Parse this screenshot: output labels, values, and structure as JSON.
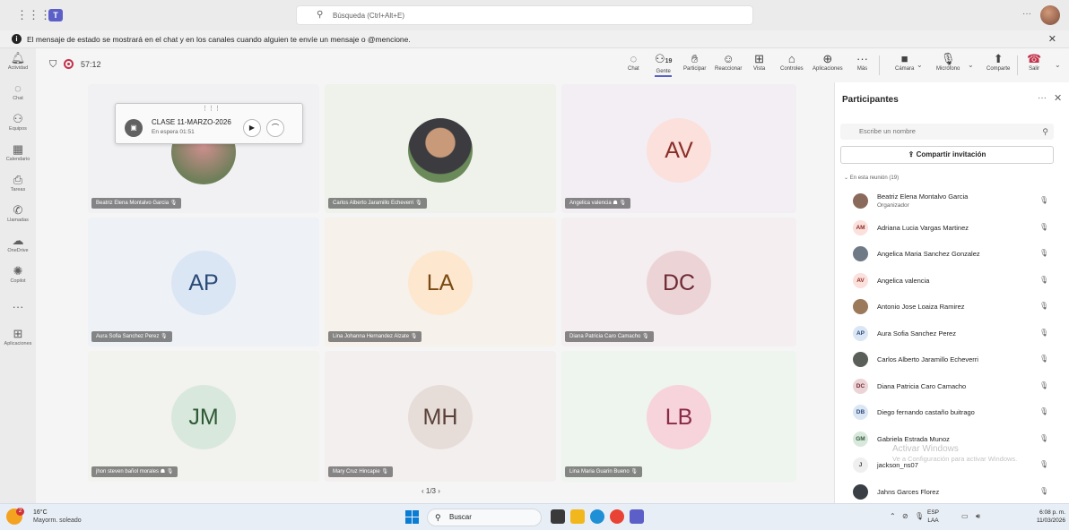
{
  "topbar": {
    "search_placeholder": "Búsqueda (Ctrl+Alt+E)",
    "more": "···"
  },
  "banner": {
    "text": "El mensaje de estado se mostrará en el chat y en los canales cuando alguien te envíe un mensaje o @mencione."
  },
  "rail": {
    "items": [
      {
        "label": "Actividad",
        "icon": "bell-icon"
      },
      {
        "label": "Chat",
        "icon": "chat-icon"
      },
      {
        "label": "Equipos",
        "icon": "teams-icon"
      },
      {
        "label": "Calendario",
        "icon": "calendar-icon"
      },
      {
        "label": "Tareas",
        "icon": "tasks-icon"
      },
      {
        "label": "Llamadas",
        "icon": "phone-icon"
      },
      {
        "label": "OneDrive",
        "icon": "cloud-icon"
      },
      {
        "label": "Copilot",
        "icon": "copilot-icon"
      },
      {
        "label": "",
        "icon": "more-icon"
      },
      {
        "label": "Aplicaciones",
        "icon": "apps-icon"
      }
    ]
  },
  "meeting": {
    "timer": "57:12",
    "controls": {
      "chat": "Chat",
      "people": "Gente",
      "people_count": "19",
      "raise": "Participar",
      "react": "Reaccionar",
      "view": "Vista",
      "controls": "Controles",
      "apps": "Aplicaciones",
      "more": "Más",
      "camera": "Cámara",
      "mic": "Micrófono",
      "share": "Comparte",
      "leave": "Salir"
    }
  },
  "popup": {
    "title": "CLASE 11-MARZO-2026",
    "status": "En espera   01:51"
  },
  "tiles": [
    {
      "name": "Beatriz Elena Montalvo Garcia",
      "initials": "",
      "bg": "#f1f1f4"
    },
    {
      "name": "Carlos Alberto Jaramillo Echeverri",
      "initials": "",
      "bg": "#eef2ea"
    },
    {
      "name": "Angelica valencia",
      "initials": "AV",
      "bg": "#f3eef4",
      "avatar_bg": "#fbe0dc",
      "avatar_fg": "#8b2e26"
    },
    {
      "name": "Aura Sofia Sanchez Perez",
      "initials": "AP",
      "bg": "#eef1f5",
      "avatar_bg": "#dbe6f4",
      "avatar_fg": "#2b4a78"
    },
    {
      "name": "Lina Johanna Hernandez Alzate",
      "initials": "LA",
      "bg": "#f6f1ea",
      "avatar_bg": "#fde7cf",
      "avatar_fg": "#7a4a10"
    },
    {
      "name": "Diana Patricia Caro Camacho",
      "initials": "DC",
      "bg": "#f4eef0",
      "avatar_bg": "#ecd3d6",
      "avatar_fg": "#6e2a34"
    },
    {
      "name": "jhon steven bañol morales",
      "initials": "JM",
      "bg": "#f2f2ee",
      "avatar_bg": "#d9e8dc",
      "avatar_fg": "#2e5a36"
    },
    {
      "name": "Mary Cruz Hincapie",
      "initials": "MH",
      "bg": "#f4efef",
      "avatar_bg": "#e6ddd9",
      "avatar_fg": "#5a4038"
    },
    {
      "name": "Lina Maria Guarin Bueno",
      "initials": "LB",
      "bg": "#eef4ee",
      "avatar_bg": "#f7d3dc",
      "avatar_fg": "#8a2a44"
    }
  ],
  "pager": "‹  1/3  ›",
  "panel": {
    "title": "Participantes",
    "search_placeholder": "Escribe un nombre",
    "invite": "Compartir invitación",
    "section": "En esta reunión (19)",
    "participants": [
      {
        "name": "Beatriz Elena Montalvo Garcia",
        "role": "Organizador",
        "initials": "",
        "av_bg": "#8a6a5a",
        "av_fg": "#fff"
      },
      {
        "name": "Adriana Lucia Vargas Martinez",
        "role": "",
        "initials": "AM",
        "av_bg": "#fbe0dc",
        "av_fg": "#8b2e26"
      },
      {
        "name": "Angelica Maria Sanchez Gonzalez",
        "role": "",
        "initials": "",
        "av_bg": "#6f7a86",
        "av_fg": "#fff"
      },
      {
        "name": "Angelica valencia",
        "role": "",
        "initials": "AV",
        "av_bg": "#fbe0dc",
        "av_fg": "#8b2e26"
      },
      {
        "name": "Antonio Jose Loaiza Ramirez",
        "role": "",
        "initials": "",
        "av_bg": "#9a7a5a",
        "av_fg": "#fff"
      },
      {
        "name": "Aura Sofia Sanchez Perez",
        "role": "",
        "initials": "AP",
        "av_bg": "#dbe6f4",
        "av_fg": "#2b4a78"
      },
      {
        "name": "Carlos Alberto Jaramillo Echeverri",
        "role": "",
        "initials": "",
        "av_bg": "#5a5f5a",
        "av_fg": "#fff"
      },
      {
        "name": "Diana Patricia Caro Camacho",
        "role": "",
        "initials": "DC",
        "av_bg": "#ecd3d6",
        "av_fg": "#6e2a34"
      },
      {
        "name": "Diego fernando castaño buitrago",
        "role": "",
        "initials": "DB",
        "av_bg": "#dbe6f4",
        "av_fg": "#2b4a78"
      },
      {
        "name": "Gabriela Estrada Munoz",
        "role": "",
        "initials": "GM",
        "av_bg": "#d9e8dc",
        "av_fg": "#2e5a36"
      },
      {
        "name": "jackson_ns07",
        "role": "",
        "initials": "J",
        "av_bg": "#efefef",
        "av_fg": "#424242"
      },
      {
        "name": "Jahns Garces Florez",
        "role": "",
        "initials": "",
        "av_bg": "#3a3f46",
        "av_fg": "#fff"
      }
    ]
  },
  "watermark": {
    "line1": "Activar Windows",
    "line2": "Ve a Configuración para activar Windows."
  },
  "taskbar": {
    "temp": "16°C",
    "weather": "Mayorm. soleado",
    "weather_badge": "2",
    "search": "Buscar",
    "lang1": "ESP",
    "lang2": "LAA",
    "time": "6:08 p. m.",
    "date": "11/03/2026"
  }
}
